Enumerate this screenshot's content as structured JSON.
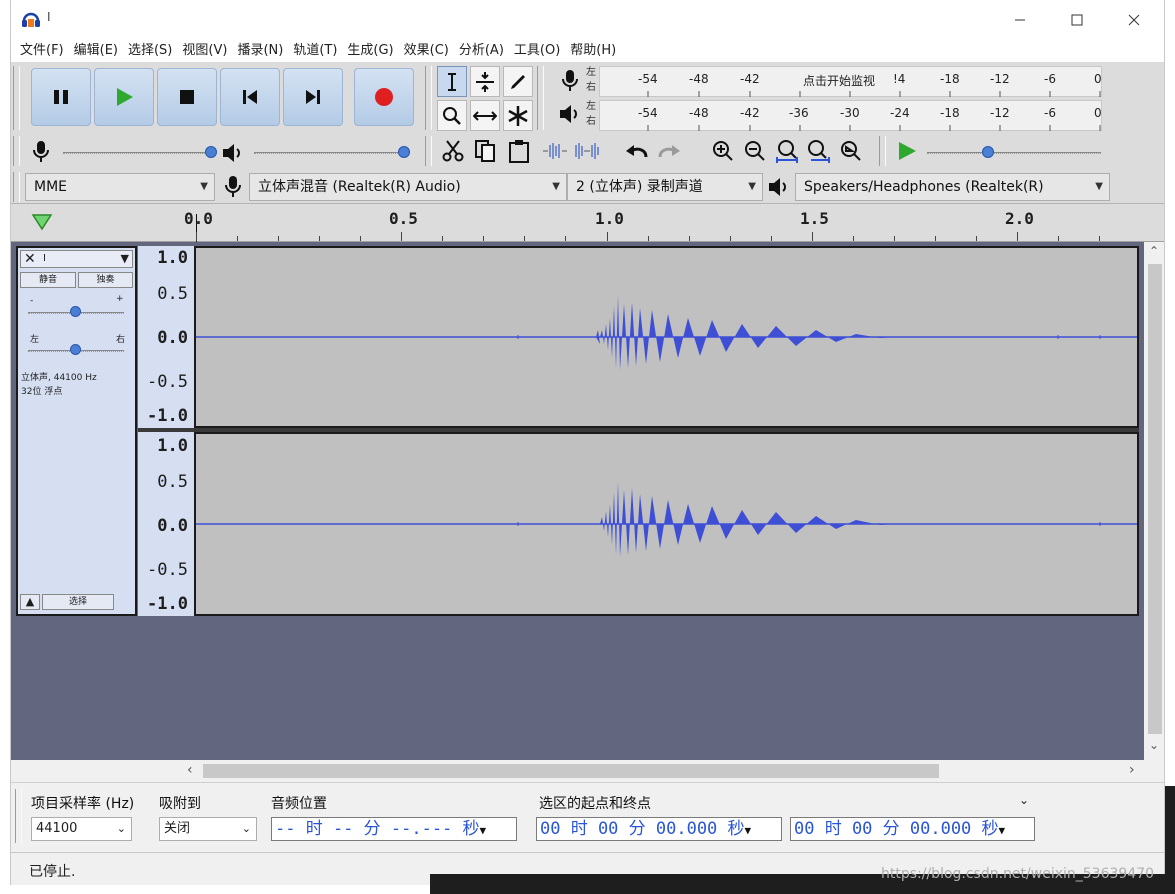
{
  "window": {
    "title": "I"
  },
  "menu": [
    "文件(F)",
    "编辑(E)",
    "选择(S)",
    "视图(V)",
    "播录(N)",
    "轨道(T)",
    "生成(G)",
    "效果(C)",
    "分析(A)",
    "工具(O)",
    "帮助(H)"
  ],
  "meters": {
    "record_scale": [
      "-54",
      "-48",
      "-42",
      "点击开始监视",
      "!4",
      "-18",
      "-12",
      "-6",
      "0"
    ],
    "play_scale": [
      "-54",
      "-48",
      "-42",
      "-36",
      "-30",
      "-24",
      "-18",
      "-12",
      "-6",
      "0"
    ],
    "channel_left": "左",
    "channel_right": "右"
  },
  "devices": {
    "host": "MME",
    "input": "立体声混音 (Realtek(R) Audio)",
    "channels": "2 (立体声) 录制声道",
    "output": "Speakers/Headphones (Realtek(R)"
  },
  "ruler": {
    "labels": [
      "0.0",
      "0.5",
      "1.0",
      "1.5",
      "2.0"
    ]
  },
  "track": {
    "name": "I",
    "mute": "静音",
    "solo": "独奏",
    "gain_minus": "-",
    "gain_plus": "+",
    "pan_left": "左",
    "pan_right": "右",
    "info_line1": "立体声, 44100 Hz",
    "info_line2": "32位 浮点",
    "select": "选择",
    "scale": [
      "1.0",
      "0.5",
      "0.0",
      "-0.5",
      "-1.0"
    ]
  },
  "bottom": {
    "rate_label": "项目采样率 (Hz)",
    "rate_value": "44100",
    "snap_label": "吸附到",
    "snap_value": "关闭",
    "pos_label": "音频位置",
    "pos_value": "-- 时 -- 分 --.--- 秒",
    "sel_label": "选区的起点和终点",
    "sel_start": "00 时 00 分 00.000 秒",
    "sel_end": "00 时 00 分 00.000 秒"
  },
  "status": {
    "text": "已停止."
  },
  "watermark": "https://blog.csdn.net/weixin_53639470",
  "colors": {
    "waveform": "#3e4fd6",
    "record": "#e02020",
    "play": "#2fa82f"
  }
}
